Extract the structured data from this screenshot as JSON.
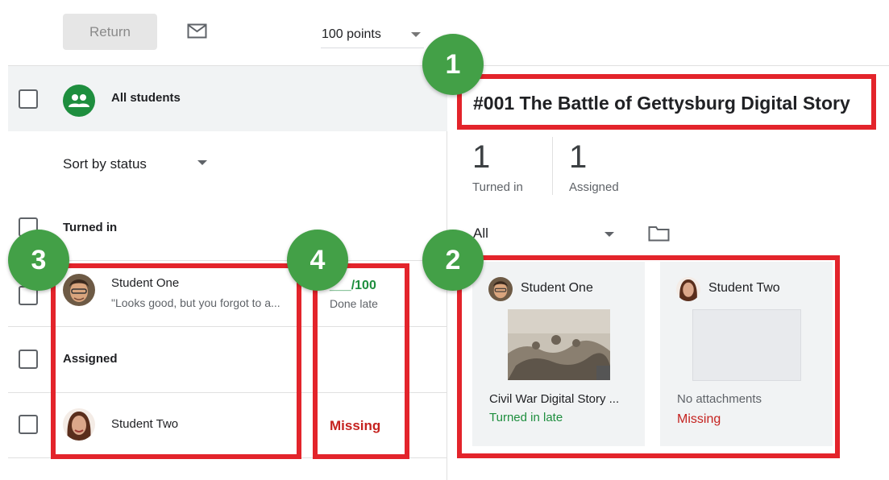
{
  "toolbar": {
    "return_label": "Return",
    "mail_icon": "mail-icon",
    "points_value": "100 points"
  },
  "roster": {
    "all_students_label": "All students",
    "group_icon": "people-icon",
    "sort_label": "Sort by status",
    "sections": [
      {
        "header": "Turned in",
        "students": [
          {
            "name": "Student One",
            "comment": "\"Looks good, but you forgot to a...",
            "grade": "___/100",
            "status": "Done late"
          }
        ]
      },
      {
        "header": "Assigned",
        "students": [
          {
            "name": "Student Two",
            "status": "Missing"
          }
        ]
      }
    ]
  },
  "assignment": {
    "title": "#001 The Battle of Gettysburg Digital Story",
    "stats": [
      {
        "count": "1",
        "label": "Turned in"
      },
      {
        "count": "1",
        "label": "Assigned"
      }
    ],
    "filter_value": "All",
    "folder_icon": "folder-icon",
    "cards": [
      {
        "name": "Student One",
        "attachment": "Civil War Digital Story ...",
        "status": "Turned in late"
      },
      {
        "name": "Student Two",
        "attachment": "No attachments",
        "status": "Missing"
      }
    ]
  },
  "annotations": {
    "badges": [
      "1",
      "2",
      "3",
      "4"
    ],
    "box_color": "#e3242b",
    "badge_color": "#43a047"
  },
  "colors": {
    "accent_green": "#1e8e3e",
    "missing_red": "#c5221f"
  }
}
